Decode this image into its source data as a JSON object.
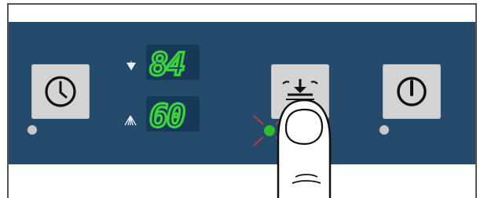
{
  "panel": {
    "display_top": {
      "value": "84",
      "icon": "triangle-down-sparkle-icon"
    },
    "display_bottom": {
      "value": "60",
      "icon": "spray-arms-icon"
    }
  },
  "buttons": [
    {
      "id": "timer",
      "icon": "clock-icon"
    },
    {
      "id": "extra-dry",
      "icon": "arrow-down-bars-icon",
      "pressed": true
    },
    {
      "id": "power",
      "icon": "power-icon"
    }
  ],
  "indicators": {
    "timer_led": "off",
    "extra_dry_led": "on-blinking",
    "power_led": "off"
  },
  "colors": {
    "panel": "#244a6c",
    "digits": "#3cd33c",
    "led_on": "#2ebd2e",
    "led_off": "#c8c8c8",
    "blink": "#e3333b"
  }
}
